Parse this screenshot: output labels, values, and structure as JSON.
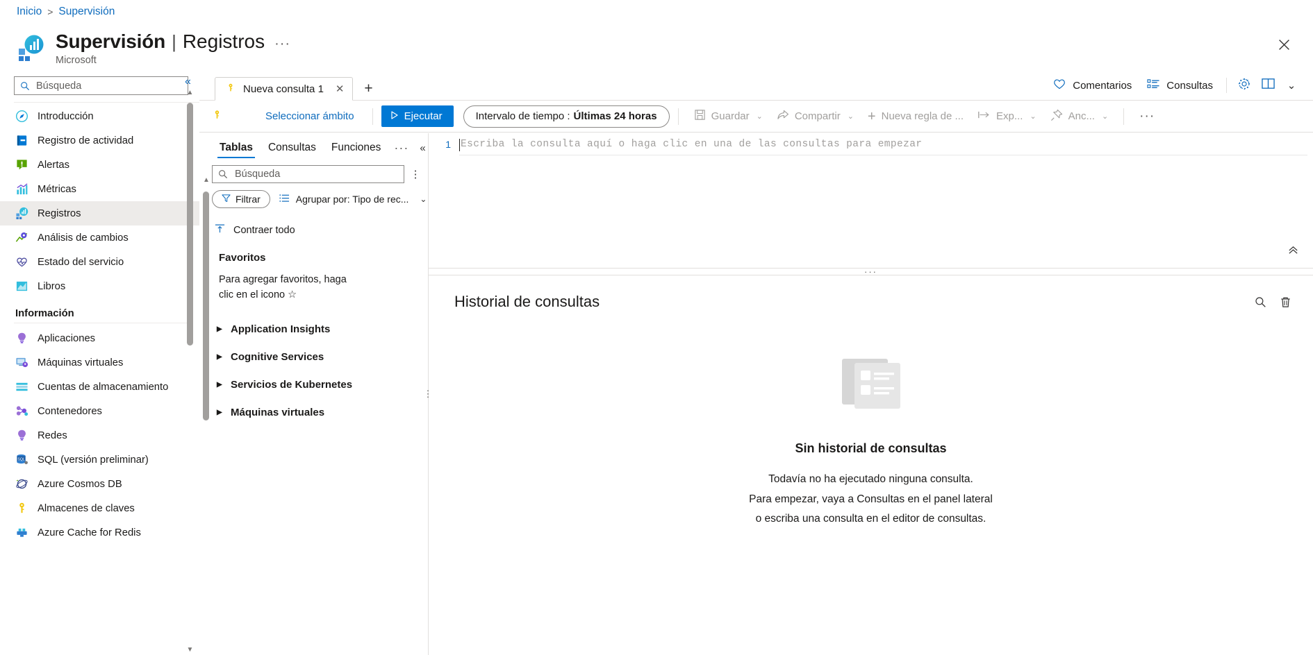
{
  "breadcrumb": {
    "home": "Inicio",
    "separator": ">",
    "current": "Supervisión"
  },
  "header": {
    "title": "Supervisión",
    "pipe": "|",
    "subtitle": "Registros",
    "ellipsis": "···",
    "caption": "Microsoft",
    "close_label": "✕"
  },
  "sidebar": {
    "search_placeholder": "Búsqueda",
    "items": [
      {
        "label": "Introducción",
        "icon": "compass-icon",
        "selected": false
      },
      {
        "label": "Registro de actividad",
        "icon": "activity-log-icon",
        "selected": false
      },
      {
        "label": "Alertas",
        "icon": "alert-icon",
        "selected": false
      },
      {
        "label": "Métricas",
        "icon": "metrics-icon",
        "selected": false
      },
      {
        "label": "Registros",
        "icon": "logs-icon",
        "selected": true
      },
      {
        "label": "Análisis de cambios",
        "icon": "change-analysis-icon",
        "selected": false
      },
      {
        "label": "Estado del servicio",
        "icon": "service-health-icon",
        "selected": false
      },
      {
        "label": "Libros",
        "icon": "workbooks-icon",
        "selected": false
      }
    ],
    "section_label": "Información",
    "insight_items": [
      {
        "label": "Aplicaciones",
        "icon": "application-insights-icon"
      },
      {
        "label": "Máquinas virtuales",
        "icon": "virtual-machines-icon"
      },
      {
        "label": "Cuentas de almacenamiento",
        "icon": "storage-accounts-icon"
      },
      {
        "label": "Contenedores",
        "icon": "containers-icon"
      },
      {
        "label": "Redes",
        "icon": "networks-icon"
      },
      {
        "label": "SQL (versión preliminar)",
        "icon": "sql-icon"
      },
      {
        "label": "Azure Cosmos DB",
        "icon": "cosmos-db-icon"
      },
      {
        "label": "Almacenes de claves",
        "icon": "key-vaults-icon"
      },
      {
        "label": "Azure Cache for Redis",
        "icon": "redis-cache-icon"
      }
    ],
    "collapse_label": "«"
  },
  "tabstrip": {
    "tab_label": "Nueva consulta 1",
    "tab_icon": "key-icon",
    "tab_close": "✕",
    "add_tab": "+",
    "feedback_label": "Comentarios",
    "queries_label": "Consultas",
    "settings_icon": "gear-icon",
    "book_icon": "book-icon",
    "chevron": "⌄"
  },
  "commandbar": {
    "scope_icon": "key-icon",
    "scope_label": "Seleccionar ámbito",
    "run_label": "Ejecutar",
    "run_icon": "play-icon",
    "timerange_prefix": "Intervalo de tiempo :",
    "timerange_value": "Últimas 24 horas",
    "save_label": "Guardar",
    "share_label": "Compartir",
    "new_alert_rule_label": "Nueva regla de ...",
    "export_label": "Exp...",
    "pin_label": "Anc...",
    "more_label": "···",
    "chevron": "⌄"
  },
  "schema": {
    "tabs": [
      {
        "label": "Tablas",
        "active": true
      },
      {
        "label": "Consultas",
        "active": false
      },
      {
        "label": "Funciones",
        "active": false
      }
    ],
    "tabs_more": "···",
    "collapse": "«",
    "search_placeholder": "Búsqueda",
    "kebab": "⋮",
    "filter_label": "Filtrar",
    "groupby_label": "Agrupar por: Tipo de rec...",
    "groupby_chevron": "⌄",
    "collapse_all_label": "Contraer todo",
    "favorites_title": "Favoritos",
    "favorites_note": "Para agregar favoritos, haga clic en el icono ☆",
    "tree": [
      {
        "label": "Application Insights"
      },
      {
        "label": "Cognitive Services"
      },
      {
        "label": "Servicios de Kubernetes"
      },
      {
        "label": "Máquinas virtuales"
      }
    ]
  },
  "editor": {
    "line_number": "1",
    "placeholder": "Escriba la consulta aquí o haga clic en una de las consultas para empezar",
    "collapse_icon": "chevron-up-icon"
  },
  "history": {
    "title": "Historial de consultas",
    "search_icon": "search-icon",
    "delete_icon": "trash-icon",
    "empty_title": "Sin historial de consultas",
    "empty_lines": [
      "Todavía no ha ejecutado ninguna consulta.",
      "Para empezar, vaya a Consultas en el panel lateral",
      "o escriba una consulta en el editor de consultas."
    ]
  },
  "colors": {
    "accent": "#0078d4",
    "link": "#0f6cbd",
    "selected_bg": "#edebe9",
    "border": "#e1dfdd",
    "muted_text": "#605e5c",
    "disabled_text": "#a19f9d"
  }
}
